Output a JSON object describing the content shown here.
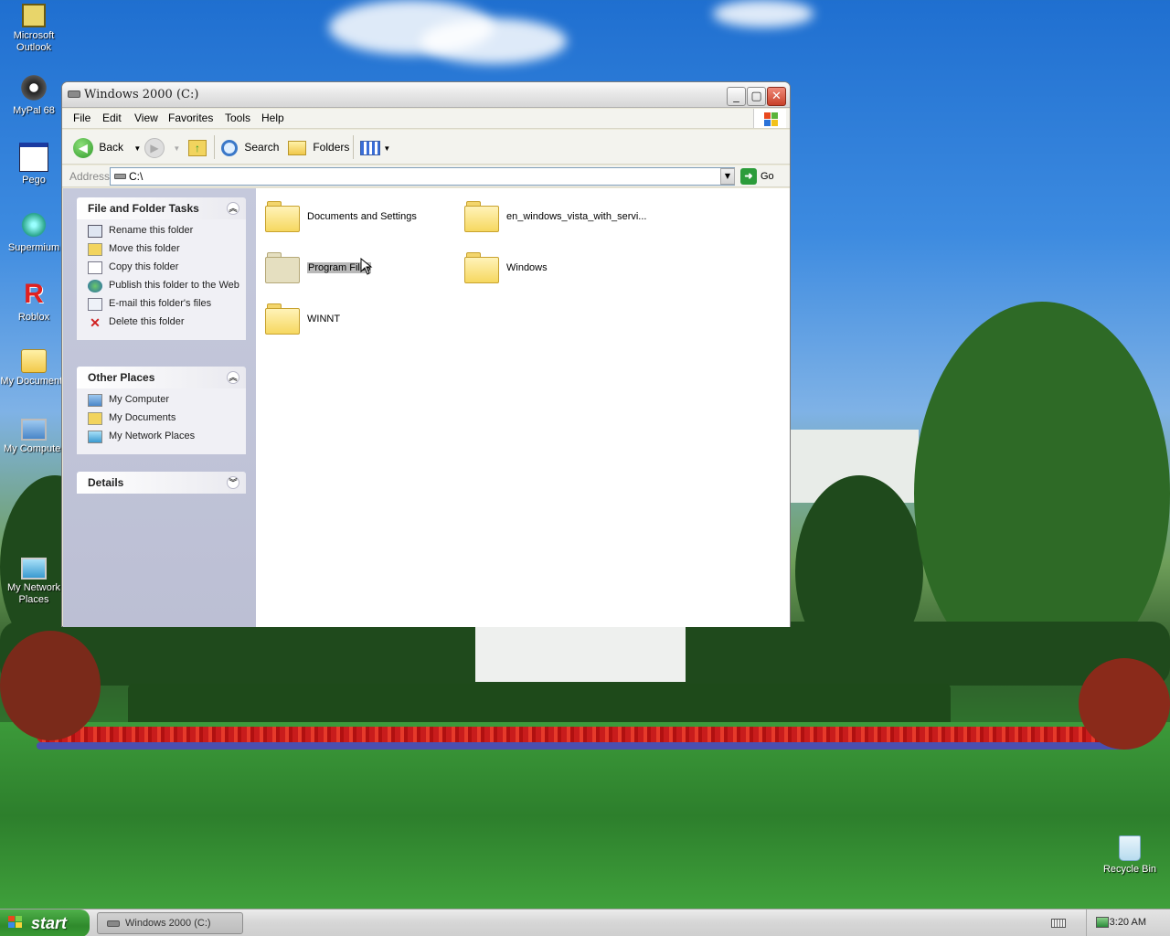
{
  "desktop": {
    "icons": [
      {
        "label": "Microsoft Outlook",
        "icon": "outlook-icon"
      },
      {
        "label": "MyPal 68",
        "icon": "mypal-icon"
      },
      {
        "label": "Pego",
        "icon": "pego-icon"
      },
      {
        "label": "Supermium",
        "icon": "supermium-icon"
      },
      {
        "label": "Roblox",
        "icon": "roblox-icon"
      },
      {
        "label": "My Documents",
        "icon": "my-documents-icon"
      },
      {
        "label": "My Computer",
        "icon": "my-computer-icon"
      },
      {
        "label": "My Network Places",
        "icon": "network-places-icon"
      },
      {
        "label": "Recycle Bin",
        "icon": "recycle-bin-icon"
      }
    ]
  },
  "window": {
    "title": "Windows 2000 (C:)",
    "menu": [
      "File",
      "Edit",
      "View",
      "Favorites",
      "Tools",
      "Help"
    ],
    "toolbar": {
      "back_label": "Back",
      "search_label": "Search",
      "folders_label": "Folders"
    },
    "address": {
      "label": "Address",
      "value": "C:\\",
      "go_label": "Go"
    },
    "left_pane": {
      "tasks": {
        "title": "File and Folder Tasks",
        "items": [
          {
            "label": "Rename this folder",
            "icon": "rename-icon"
          },
          {
            "label": "Move this folder",
            "icon": "move-icon"
          },
          {
            "label": "Copy this folder",
            "icon": "copy-icon"
          },
          {
            "label": "Publish this folder to the Web",
            "icon": "publish-web-icon"
          },
          {
            "label": "E-mail this folder's files",
            "icon": "email-icon"
          },
          {
            "label": "Delete this folder",
            "icon": "delete-icon"
          }
        ]
      },
      "places": {
        "title": "Other Places",
        "items": [
          {
            "label": "My Computer",
            "icon": "my-computer-icon"
          },
          {
            "label": "My Documents",
            "icon": "my-documents-icon"
          },
          {
            "label": "My Network Places",
            "icon": "network-places-icon"
          }
        ]
      },
      "details": {
        "title": "Details"
      }
    },
    "folders": [
      {
        "name": "Documents and Settings"
      },
      {
        "name": "en_windows_vista_with_servi..."
      },
      {
        "name": "Program Files",
        "selected": true
      },
      {
        "name": "Windows"
      },
      {
        "name": "WINNT"
      }
    ]
  },
  "taskbar": {
    "start_label": "start",
    "task_item": "Windows 2000 (C:)",
    "clock": "3:20 AM"
  }
}
